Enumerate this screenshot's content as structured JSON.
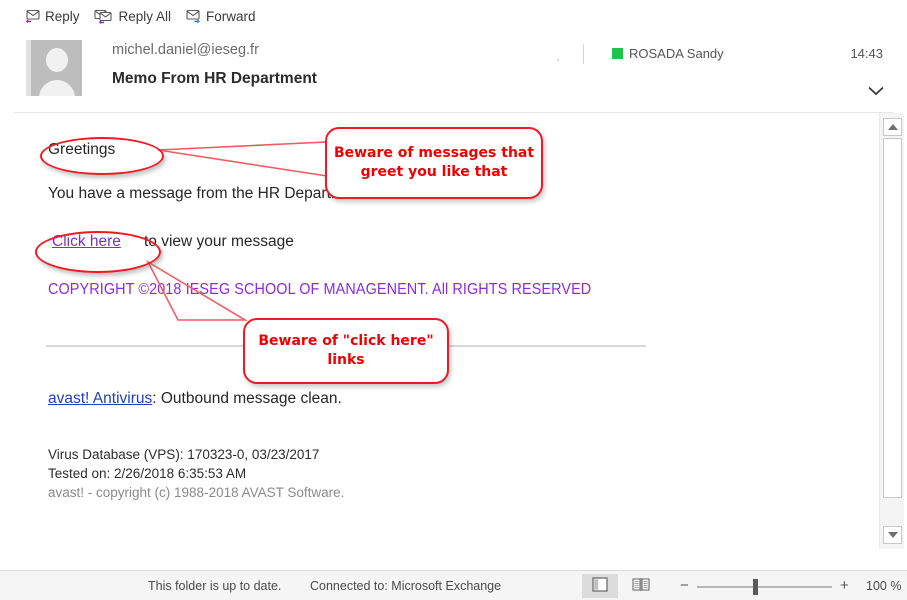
{
  "toolbar": {
    "reply_label": "Reply",
    "reply_all_label": "Reply All",
    "forward_label": "Forward"
  },
  "header": {
    "sender_email": "michel.daniel@ieseg.fr",
    "subject": "Memo From HR Department",
    "separator_dot": "·",
    "recipient_name": "ROSADA Sandy",
    "presence_color": "#21c24a",
    "time": "14:43"
  },
  "body": {
    "greeting": "Greetings",
    "message_line": "You have a message from the HR Department",
    "click_link": "Click here",
    "click_rest": "to view your message",
    "copyright": "COPYRIGHT ©2018 IESEG SCHOOL OF MANAGENENT. All RIGHTS RESERVED",
    "avast_link": "avast! Antivirus",
    "avast_rest": ": Outbound message clean.",
    "virus_database": "Virus Database (VPS): 170323-0, 03/23/2017",
    "tested_on": "Tested on: 2/26/2018 6:35:53 AM",
    "avast_copyright": "avast! - copyright (c) 1988-2018 AVAST Software."
  },
  "annotations": {
    "color": "#f00000",
    "callout_greetings": "Beware of messages that greet you like that",
    "callout_clickhere": "Beware of \"click here\" links"
  },
  "status": {
    "folder_status": "This folder is up to date.",
    "connection": "Connected to: Microsoft Exchange",
    "zoom_level": "100 %",
    "zoom_minus": "−",
    "zoom_plus": "+"
  }
}
